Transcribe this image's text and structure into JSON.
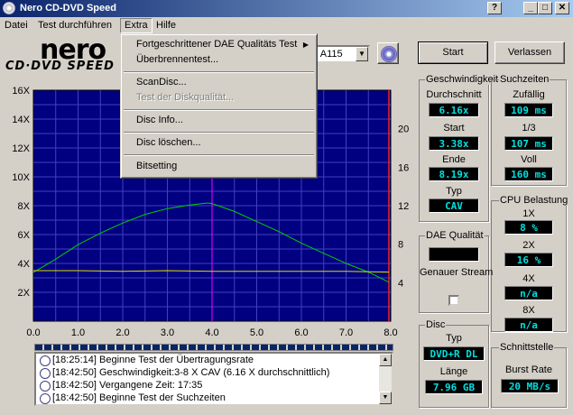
{
  "window": {
    "title": "Nero CD-DVD Speed"
  },
  "menubar": {
    "items": [
      "Datei",
      "Test durchführen",
      "Extra",
      "Hilfe"
    ],
    "active": "Extra"
  },
  "extra_menu": {
    "items": [
      {
        "label": "Fortgeschrittener DAE Qualitäts Test",
        "submenu": true,
        "enabled": true
      },
      {
        "label": "Überbrennentest...",
        "enabled": true
      },
      {
        "label": "ScanDisc...",
        "enabled": true
      },
      {
        "label": "Test der Diskqualität...",
        "enabled": false
      },
      {
        "label": "Disc Info...",
        "enabled": true
      },
      {
        "label": "Disc löschen...",
        "enabled": true
      },
      {
        "label": "Bitsetting",
        "enabled": true
      }
    ]
  },
  "logo": {
    "brand": "nero",
    "product": "CD·DVD SPEED"
  },
  "drive": {
    "selected": "B A115"
  },
  "buttons": {
    "start": "Start",
    "exit": "Verlassen"
  },
  "chart_data": {
    "type": "line",
    "background": "#000080",
    "grid": true,
    "x": {
      "min": 0,
      "max": 8,
      "ticks": [
        "0.0",
        "1.0",
        "2.0",
        "3.0",
        "4.0",
        "5.0",
        "6.0",
        "7.0",
        "8.0"
      ]
    },
    "y_left": {
      "min": 0,
      "max": 16,
      "ticks": [
        "2X",
        "4X",
        "6X",
        "8X",
        "10X",
        "12X",
        "14X",
        "16X"
      ]
    },
    "y_right": {
      "min": 0,
      "max": 24,
      "ticks": [
        "4",
        "8",
        "12",
        "16",
        "20"
      ]
    },
    "markers": {
      "magenta_x": 4.0,
      "red_x": 7.96
    },
    "series": [
      {
        "color": "#00d000",
        "points": [
          [
            0.0,
            3.38
          ],
          [
            0.5,
            4.3
          ],
          [
            1.0,
            5.3
          ],
          [
            1.5,
            6.1
          ],
          [
            2.0,
            6.8
          ],
          [
            2.5,
            7.4
          ],
          [
            3.0,
            7.8
          ],
          [
            3.5,
            8.05
          ],
          [
            3.9,
            8.19
          ],
          [
            4.0,
            8.15
          ],
          [
            4.5,
            7.6
          ],
          [
            5.0,
            6.9
          ],
          [
            5.5,
            6.2
          ],
          [
            6.0,
            5.4
          ],
          [
            6.5,
            4.7
          ],
          [
            7.0,
            4.0
          ],
          [
            7.5,
            3.4
          ],
          [
            7.96,
            2.7
          ]
        ]
      },
      {
        "color": "#e0e000",
        "points": [
          [
            0.0,
            3.5
          ],
          [
            1.0,
            3.5
          ],
          [
            2.0,
            3.45
          ],
          [
            3.0,
            3.5
          ],
          [
            4.0,
            3.45
          ],
          [
            5.0,
            3.45
          ],
          [
            6.0,
            3.45
          ],
          [
            7.0,
            3.45
          ],
          [
            7.96,
            3.4
          ]
        ]
      }
    ]
  },
  "log": {
    "entries": [
      {
        "time": "[18:25:14]",
        "text": "Beginne Test der Übertragungsrate"
      },
      {
        "time": "[18:42:50]",
        "text": "Geschwindigkeit:3-8 X CAV (6.16 X durchschnittlich)"
      },
      {
        "time": "[18:42:50]",
        "text": "Vergangene Zeit: 17:35"
      },
      {
        "time": "[18:42:50]",
        "text": "Beginne Test der Suchzeiten"
      }
    ]
  },
  "speed_panel": {
    "title": "Geschwindigkeit",
    "average_label": "Durchschnitt",
    "average": "6.16x",
    "start_label": "Start",
    "start": "3.38x",
    "end_label": "Ende",
    "end": "8.19x",
    "type_label": "Typ",
    "type": "CAV"
  },
  "seek_panel": {
    "title": "Suchzeiten",
    "random_label": "Zufällig",
    "random": "109 ms",
    "third_label": "1/3",
    "third": "107 ms",
    "full_label": "Voll",
    "full": "160 ms"
  },
  "cpu_panel": {
    "title": "CPU Belastung",
    "x1_label": "1X",
    "x1": "8 %",
    "x2_label": "2X",
    "x2": "16 %",
    "x4_label": "4X",
    "x4": "n/a",
    "x8_label": "8X",
    "x8": "n/a"
  },
  "dae_panel": {
    "title": "DAE Qualität",
    "exact_stream_label": "Genauer Stream"
  },
  "disc_panel": {
    "title": "Disc",
    "type_label": "Typ",
    "type": "DVD+R DL",
    "length_label": "Länge",
    "length": "7.96 GB"
  },
  "interface_panel": {
    "title": "Schnittstelle",
    "burst_label": "Burst Rate",
    "burst": "20 MB/s"
  }
}
